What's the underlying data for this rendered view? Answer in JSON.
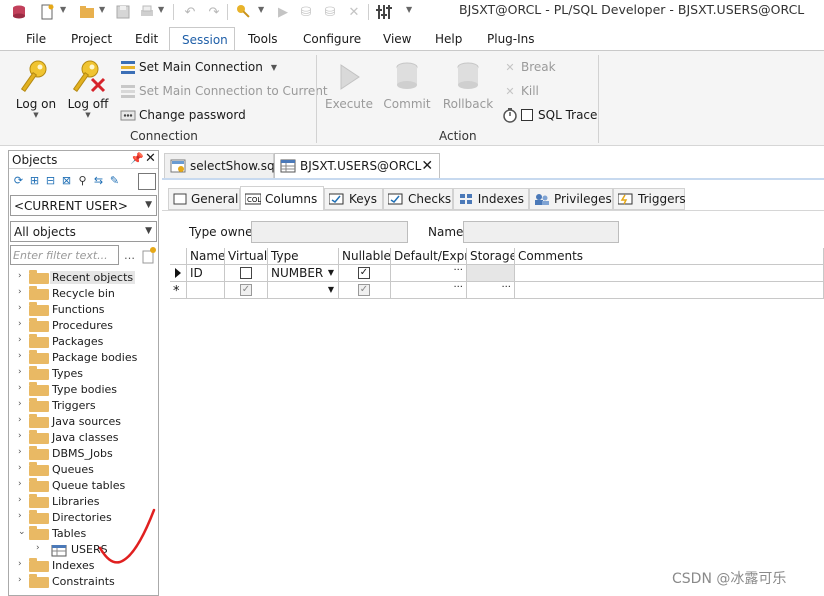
{
  "window": {
    "title": "BJSXT@ORCL - PL/SQL Developer - BJSXT.USERS@ORCL"
  },
  "menu": {
    "items": [
      "File",
      "Project",
      "Edit",
      "Session",
      "Tools",
      "Configure",
      "View",
      "Help",
      "Plug-Ins"
    ],
    "active": "Session"
  },
  "ribbon": {
    "connection": {
      "log_on": "Log on",
      "log_off": "Log off",
      "set_main_connection": "Set Main Connection",
      "set_main_to_current": "Set Main Connection to Current",
      "change_password": "Change password",
      "group_label": "Connection"
    },
    "action": {
      "execute": "Execute",
      "commit": "Commit",
      "rollback": "Rollback",
      "break": "Break",
      "kill": "Kill",
      "sql_trace": "SQL Trace",
      "group_label": "Action"
    }
  },
  "objects_panel": {
    "title": "Objects",
    "user_combo": "<CURRENT USER>",
    "filter_combo": "All objects",
    "filter_placeholder": "Enter filter text...",
    "tree": [
      "Recent objects",
      "Recycle bin",
      "Functions",
      "Procedures",
      "Packages",
      "Package bodies",
      "Types",
      "Type bodies",
      "Triggers",
      "Java sources",
      "Java classes",
      "DBMS_Jobs",
      "Queues",
      "Queue tables",
      "Libraries",
      "Directories",
      "Tables",
      "USERS",
      "Indexes",
      "Constraints"
    ]
  },
  "doc_tabs": {
    "tab1": "selectShow.sql",
    "tab2": "BJSXT.USERS@ORCL"
  },
  "editor": {
    "subtabs": [
      "General",
      "Columns",
      "Keys",
      "Checks",
      "Indexes",
      "Privileges",
      "Triggers"
    ],
    "active_subtab": "Columns",
    "type_owner_label": "Type owner",
    "name_label": "Name",
    "grid": {
      "headers": [
        "Name",
        "Virtual",
        "Type",
        "Nullable",
        "Default/Expr.",
        "Storage",
        "Comments"
      ],
      "row1": {
        "name": "ID",
        "type": "NUMBER"
      }
    }
  },
  "watermark": "CSDN @冰露可乐",
  "colors": {
    "accent": "#1f5fa8",
    "folder": "#e9b964",
    "ribbon_bg": "#f5f5f5"
  }
}
